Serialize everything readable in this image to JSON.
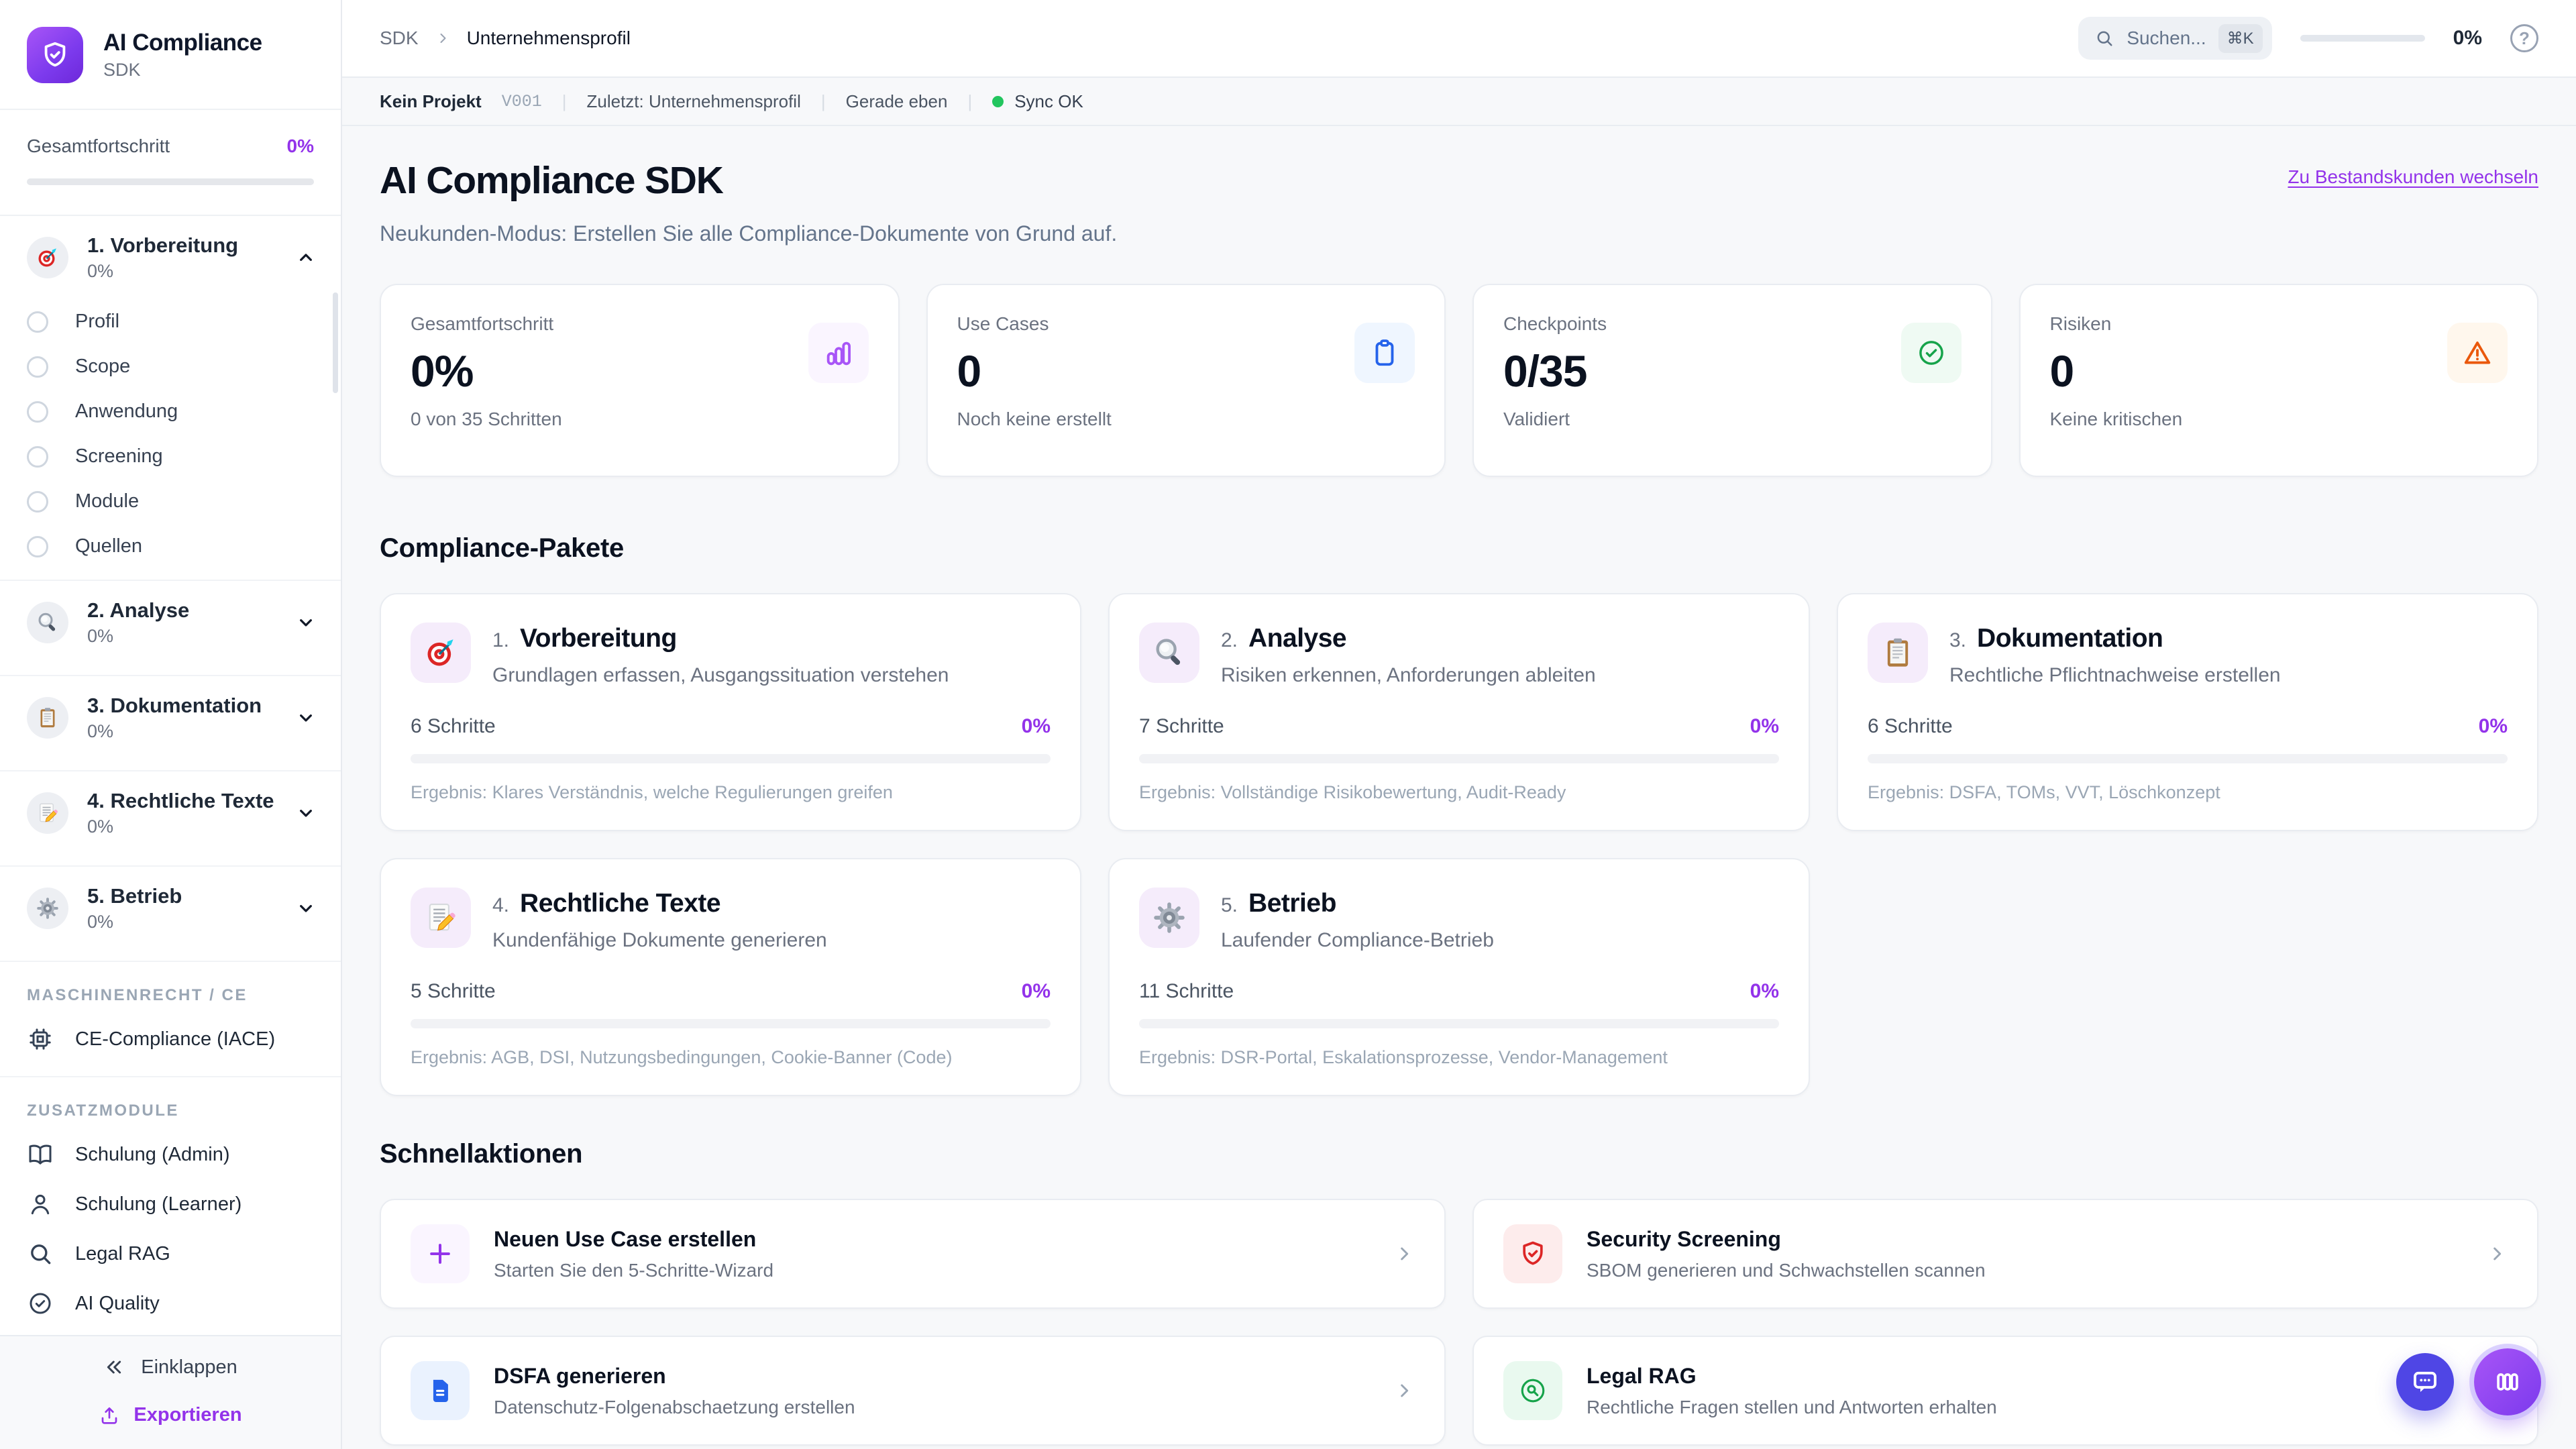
{
  "colors": {
    "accent": "#9333ea",
    "brand_gradient_start": "#a855f7",
    "brand_gradient_end": "#6d28d9",
    "sync_ok_dot": "#22c55e",
    "fab_chat": "#4f46e5",
    "fab_workspace": "#8b5cf6"
  },
  "sidebar": {
    "brand": {
      "title": "AI Compliance",
      "subtitle": "SDK",
      "logo_icon": "shield-check-icon"
    },
    "overall": {
      "label": "Gesamtfortschritt",
      "value": "0%",
      "progress_pct": 0
    },
    "phases": [
      {
        "name": "1. Vorbereitung",
        "pct": "0%",
        "icon": "target-icon",
        "state": "expanded",
        "children": [
          "Profil",
          "Scope",
          "Anwendung",
          "Screening",
          "Module",
          "Quellen"
        ]
      },
      {
        "name": "2. Analyse",
        "pct": "0%",
        "icon": "magnifier-icon",
        "state": "collapsed",
        "children": []
      },
      {
        "name": "3. Dokumentation",
        "pct": "0%",
        "icon": "clipboard-icon",
        "state": "collapsed",
        "children": []
      },
      {
        "name": "4. Rechtliche Texte",
        "pct": "0%",
        "icon": "memo-icon",
        "state": "collapsed",
        "children": []
      },
      {
        "name": "5. Betrieb",
        "pct": "0%",
        "icon": "gear-icon",
        "state": "collapsed",
        "children": []
      }
    ],
    "sections": [
      {
        "label": "MASCHINENRECHT / CE",
        "bordered": "yes",
        "items": [
          {
            "label": "CE-Compliance (IACE)",
            "icon": "cpu-icon"
          }
        ]
      },
      {
        "label": "ZUSATZMODULE",
        "bordered": "no",
        "items": [
          {
            "label": "Schulung (Admin)",
            "icon": "book-icon"
          },
          {
            "label": "Schulung (Learner)",
            "icon": "user-icon"
          },
          {
            "label": "Legal RAG",
            "icon": "search-icon"
          },
          {
            "label": "AI Quality",
            "icon": "check-circle-icon"
          }
        ]
      }
    ],
    "footer": {
      "collapse": "Einklappen",
      "export": "Exportieren"
    }
  },
  "topbar": {
    "breadcrumb": [
      "SDK",
      "Unternehmensprofil"
    ],
    "search": {
      "placeholder": "Suchen...",
      "shortcut": "⌘K"
    },
    "progress_value": "0%",
    "progress_pct": 0
  },
  "statusbar": {
    "project": "Kein Projekt",
    "version": "V001",
    "separator": "|",
    "last": "Zuletzt: Unternehmensprofil",
    "time": "Gerade eben",
    "sync": "Sync OK"
  },
  "hero": {
    "title": "AI Compliance SDK",
    "subtitle": "Neukunden-Modus: Erstellen Sie alle Compliance-Dokumente von Grund auf.",
    "switch_link": "Zu Bestandskunden wechseln"
  },
  "stats": [
    {
      "label": "Gesamtfortschritt",
      "value": "0%",
      "sub": "0 von 35 Schritten",
      "icon": "bar-chart-icon",
      "icon_color": "#a855f7",
      "icon_bg": "#faf5ff"
    },
    {
      "label": "Use Cases",
      "value": "0",
      "sub": "Noch keine erstellt",
      "icon": "clipboard-outline-icon",
      "icon_color": "#2563eb",
      "icon_bg": "#eff6ff"
    },
    {
      "label": "Checkpoints",
      "value": "0/35",
      "sub": "Validiert",
      "icon": "check-circle-icon",
      "icon_color": "#16a34a",
      "icon_bg": "#effaf3"
    },
    {
      "label": "Risiken",
      "value": "0",
      "sub": "Keine kritischen",
      "icon": "alert-triangle-icon",
      "icon_color": "#ea580c",
      "icon_bg": "#fff7ed"
    }
  ],
  "packages": {
    "heading": "Compliance-Pakete",
    "cards": [
      {
        "num": "1.",
        "title": "Vorbereitung",
        "desc": "Grundlagen erfassen, Ausgangssituation verstehen",
        "steps": "6 Schritte",
        "pct": "0%",
        "progress_pct": 0,
        "icon": "target-icon",
        "result": "Ergebnis: Klares Verständnis, welche Regulierungen greifen"
      },
      {
        "num": "2.",
        "title": "Analyse",
        "desc": "Risiken erkennen, Anforderungen ableiten",
        "steps": "7 Schritte",
        "pct": "0%",
        "progress_pct": 0,
        "icon": "magnifier-icon",
        "result": "Ergebnis: Vollständige Risikobewertung, Audit-Ready"
      },
      {
        "num": "3.",
        "title": "Dokumentation",
        "desc": "Rechtliche Pflichtnachweise erstellen",
        "steps": "6 Schritte",
        "pct": "0%",
        "progress_pct": 0,
        "icon": "clipboard-icon",
        "result": "Ergebnis: DSFA, TOMs, VVT, Löschkonzept"
      },
      {
        "num": "4.",
        "title": "Rechtliche Texte",
        "desc": "Kundenfähige Dokumente generieren",
        "steps": "5 Schritte",
        "pct": "0%",
        "progress_pct": 0,
        "icon": "memo-icon",
        "result": "Ergebnis: AGB, DSI, Nutzungsbedingungen, Cookie-Banner (Code)"
      },
      {
        "num": "5.",
        "title": "Betrieb",
        "desc": "Laufender Compliance-Betrieb",
        "steps": "11 Schritte",
        "pct": "0%",
        "progress_pct": 0,
        "icon": "gear-icon",
        "result": "Ergebnis: DSR-Portal, Eskalationsprozesse, Vendor-Management"
      }
    ]
  },
  "quick": {
    "heading": "Schnellaktionen",
    "actions": [
      {
        "title": "Neuen Use Case erstellen",
        "desc": "Starten Sie den 5-Schritte-Wizard",
        "icon": "plus-icon",
        "icon_color": "#9333ea",
        "icon_bg": "#faf5ff"
      },
      {
        "title": "Security Screening",
        "desc": "SBOM generieren und Schwachstellen scannen",
        "icon": "shield-check-icon",
        "icon_color": "#dc2626",
        "icon_bg": "#fdecec"
      },
      {
        "title": "DSFA generieren",
        "desc": "Datenschutz-Folgenabschaetzung erstellen",
        "icon": "document-icon",
        "icon_color": "#2563eb",
        "icon_bg": "#eaf2fe"
      },
      {
        "title": "Legal RAG",
        "desc": "Rechtliche Fragen stellen und Antworten erhalten",
        "icon": "search-circle-icon",
        "icon_color": "#16a34a",
        "icon_bg": "#e9f9ef"
      }
    ]
  },
  "fabs": [
    {
      "icon": "chat-icon",
      "kind": "chat"
    },
    {
      "icon": "columns-icon",
      "kind": "cols"
    }
  ]
}
